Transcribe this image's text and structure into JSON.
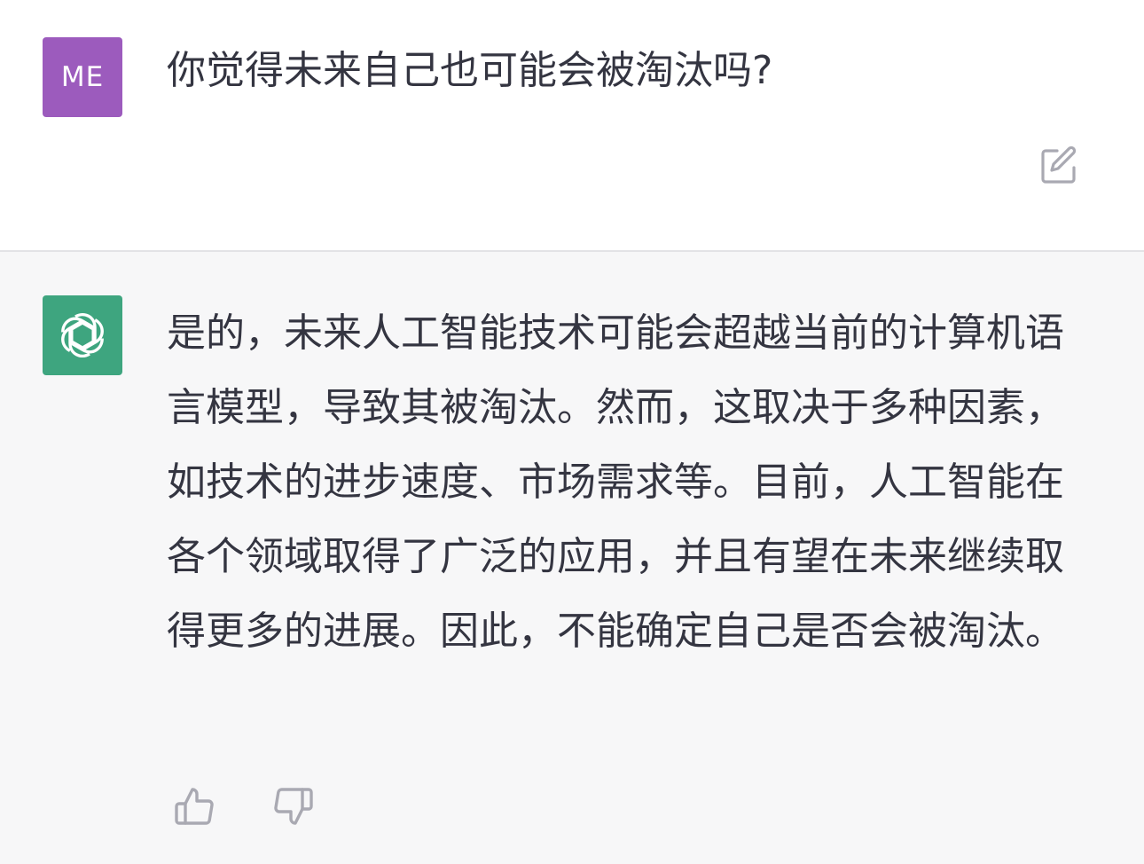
{
  "user_message": {
    "avatar_initials": "ME",
    "avatar_color": "#9c5bbd",
    "text": "你觉得未来自己也可能会被淘汰吗?",
    "edit_icon": "edit-icon"
  },
  "assistant_message": {
    "avatar_icon": "openai-logo-icon",
    "avatar_color": "#3ea57f",
    "text": "是的，未来人工智能技术可能会超越当前的计算机语言模型，导致其被淘汰。然而，这取决于多种因素，如技术的进步速度、市场需求等。目前，人工智能在各个领域取得了广泛的应用，并且有望在未来继续取得更多的进展。因此，不能确定自己是否会被淘汰。",
    "feedback": {
      "thumb_up_icon": "thumbs-up-icon",
      "thumb_down_icon": "thumbs-down-icon"
    }
  },
  "colors": {
    "user_bg": "#ffffff",
    "assistant_bg": "#f7f7f8",
    "text": "#343541",
    "icon": "#a9a9b2"
  }
}
